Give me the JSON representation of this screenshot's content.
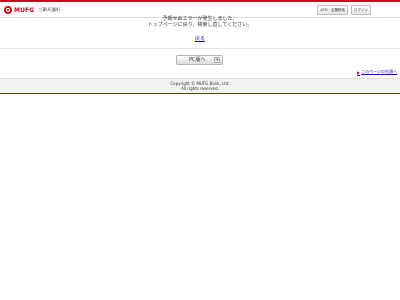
{
  "header": {
    "logo_text": "MUFG",
    "bank_name": "三菱UFJ銀行",
    "buttons": [
      {
        "label": "ATM・店舗検索"
      },
      {
        "label": "ログイン"
      }
    ]
  },
  "main": {
    "message_line1": "予期せぬエラーが発生しました。",
    "message_line2": "トップページに戻り、検索し直してください。",
    "back_link": "戻る",
    "pc_button_label": "PC版へ",
    "pc_button_plus": "+",
    "page_top_link": "このページの先頭へ"
  },
  "footer": {
    "copyright_line1": "Copyright © MUFG Bank, Ltd.",
    "copyright_line2": "All rights reserved."
  },
  "colors": {
    "brand_red": "#d6001c",
    "link_blue": "#1a0dab"
  }
}
